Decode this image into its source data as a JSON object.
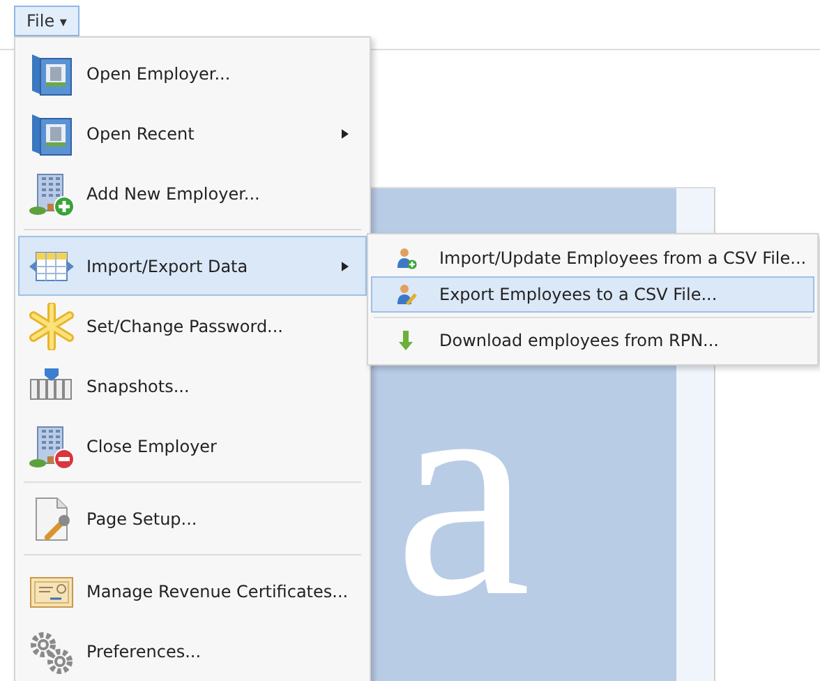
{
  "menu_bar": {
    "label": "File",
    "caret": "▾",
    "selected": true
  },
  "background_logo": {
    "text": "a"
  },
  "file_menu": [
    {
      "kind": "item",
      "label": "Open Employer...",
      "selected": false,
      "has_submenu": false
    },
    {
      "kind": "item",
      "label": "Open Recent",
      "selected": false,
      "has_submenu": true
    },
    {
      "kind": "item",
      "label": "Add New Employer...",
      "selected": false,
      "has_submenu": false
    },
    {
      "kind": "separator"
    },
    {
      "kind": "item",
      "label": "Import/Export Data",
      "selected": true,
      "has_submenu": true
    },
    {
      "kind": "item",
      "label": "Set/Change Password...",
      "selected": false,
      "has_submenu": false
    },
    {
      "kind": "item",
      "label": "Snapshots...",
      "selected": false,
      "has_submenu": false
    },
    {
      "kind": "item",
      "label": "Close Employer",
      "selected": false,
      "has_submenu": false
    },
    {
      "kind": "separator"
    },
    {
      "kind": "item",
      "label": "Page Setup...",
      "selected": false,
      "has_submenu": false
    },
    {
      "kind": "separator"
    },
    {
      "kind": "item",
      "label": "Manage Revenue Certificates...",
      "selected": false,
      "has_submenu": false
    },
    {
      "kind": "item",
      "label": "Preferences...",
      "selected": false,
      "has_submenu": false
    }
  ],
  "import_export_submenu": [
    {
      "kind": "item",
      "label": "Import/Update Employees from a CSV File...",
      "selected": false
    },
    {
      "kind": "item",
      "label": "Export Employees to a CSV File...",
      "selected": true
    },
    {
      "kind": "separator"
    },
    {
      "kind": "item",
      "label": "Download employees from RPN...",
      "selected": false
    }
  ]
}
